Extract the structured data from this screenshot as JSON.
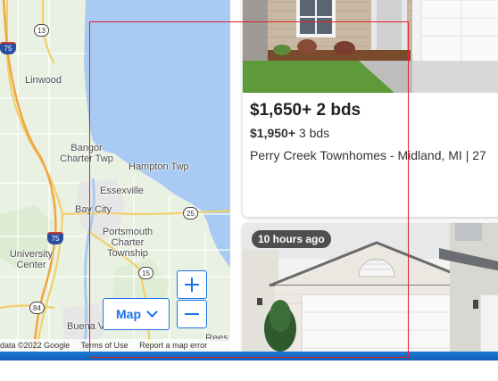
{
  "map": {
    "labels": {
      "linwood": "Linwood",
      "bangor_charter_twp": "Bangor Charter Twp",
      "hampton_twp": "Hampton Twp",
      "essexville": "Essexville",
      "bay_city": "Bay City",
      "portsmouth_charter_township": "Portsmouth Charter Township",
      "university_center": "University Center",
      "buena_vista": "Buena V",
      "rees": "Rees"
    },
    "shields": {
      "i75_top": "75",
      "i75_mid": "75",
      "m13": "13",
      "m25": "25",
      "m15": "15",
      "m84": "84"
    },
    "controls": {
      "map_type_label": "Map",
      "zoom_in_label": "+",
      "zoom_out_label": "−"
    },
    "attribution": {
      "data": "data ©2022 Google",
      "terms": "Terms of Use",
      "report": "Report a map error"
    },
    "colors": {
      "water": "#a9caf2",
      "land": "#e9f1e3",
      "accent": "#1a73e8"
    }
  },
  "listings": [
    {
      "price_main": "$1,650+ 2 bds",
      "price_secondary": "$1,950+",
      "price_secondary_beds": "3 bds",
      "address": "Perry Creek Townhomes - Midland, MI | 27"
    },
    {
      "time_badge": "10 hours ago"
    }
  ],
  "annotation": {
    "color": "#e3202a"
  }
}
